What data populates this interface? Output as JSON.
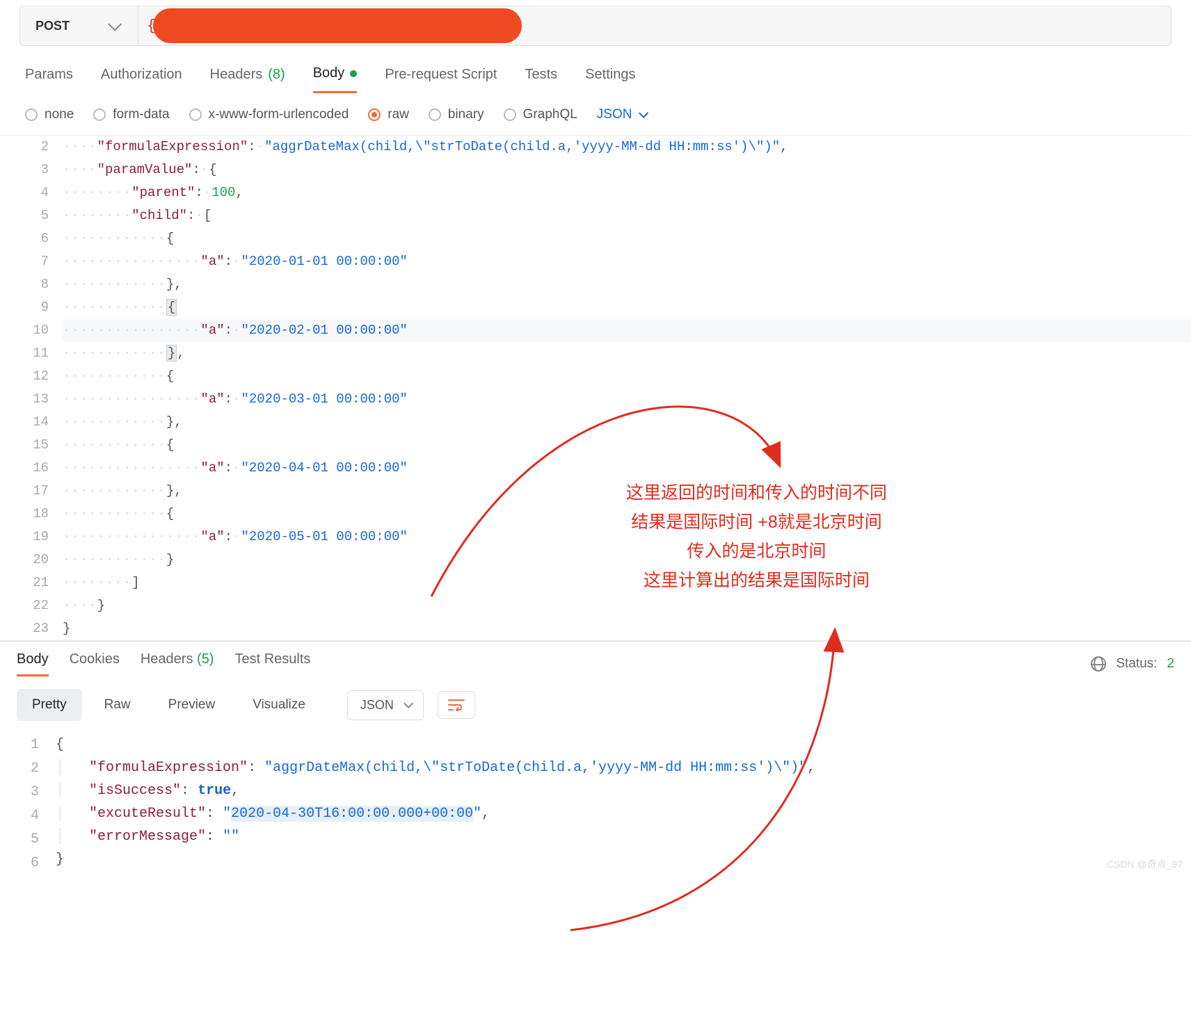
{
  "request": {
    "method": "POST",
    "url_prefix": "{"
  },
  "tabs": {
    "params": "Params",
    "authorization": "Authorization",
    "headers": "Headers",
    "headers_count": "(8)",
    "body": "Body",
    "prerequest": "Pre-request Script",
    "tests": "Tests",
    "settings": "Settings"
  },
  "body_types": {
    "none": "none",
    "formdata": "form-data",
    "xwww": "x-www-form-urlencoded",
    "raw": "raw",
    "binary": "binary",
    "graphql": "GraphQL",
    "format": "JSON"
  },
  "request_body": {
    "lines": [
      2,
      3,
      4,
      5,
      6,
      7,
      8,
      9,
      10,
      11,
      12,
      13,
      14,
      15,
      16,
      17,
      18,
      19,
      20,
      21,
      22,
      23
    ],
    "formula_key": "\"formulaExpression\"",
    "formula_val": "\"aggrDateMax(child,\\\"strToDate(child.a,'yyyy-MM-dd HH:mm:ss')\\\")\"",
    "paramValue_key": "\"paramValue\"",
    "parent_key": "\"parent\"",
    "parent_val": "100",
    "child_key": "\"child\"",
    "a_key": "\"a\"",
    "a1": "\"2020-01-01 00:00:00\"",
    "a2": "\"2020-02-01 00:00:00\"",
    "a3": "\"2020-03-01 00:00:00\"",
    "a4": "\"2020-04-01 00:00:00\"",
    "a5": "\"2020-05-01 00:00:00\""
  },
  "response_tabs": {
    "body": "Body",
    "cookies": "Cookies",
    "headers": "Headers",
    "headers_count": "(5)",
    "test_results": "Test Results"
  },
  "status": {
    "label": "Status:",
    "value": "2"
  },
  "view_mode": {
    "pretty": "Pretty",
    "raw": "Raw",
    "preview": "Preview",
    "visualize": "Visualize",
    "format": "JSON"
  },
  "response_body": {
    "lines": [
      1,
      2,
      3,
      4,
      5,
      6
    ],
    "formula_key": "\"formulaExpression\"",
    "formula_val": "\"aggrDateMax(child,\\\"strToDate(child.a,'yyyy-MM-dd HH:mm:ss')\\\")\"",
    "isSuccess_key": "\"isSuccess\"",
    "isSuccess_val": "true",
    "excute_key": "\"excuteResult\"",
    "excute_val": "\"2020-04-30T16:00:00.000+00:00\"",
    "error_key": "\"errorMessage\"",
    "error_val": "\"\""
  },
  "annotation": {
    "text": "这里返回的时间和传入的时间不同\n结果是国际时间 +8就是北京时间\n传入的是北京时间\n这里计算出的结果是国际时间"
  },
  "watermark": "CSDN @奇点_97"
}
